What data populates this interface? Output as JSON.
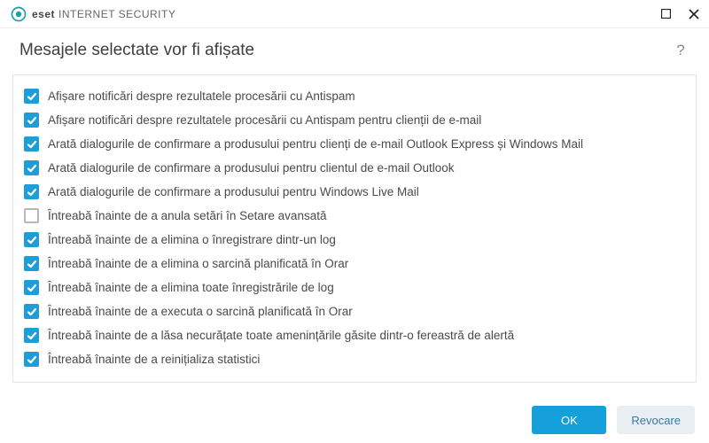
{
  "brand": {
    "bold": "eset",
    "light": "INTERNET SECURITY"
  },
  "title": "Mesajele selectate vor fi afișate",
  "help": "?",
  "items": [
    {
      "checked": true,
      "label": "Afișare notificări despre rezultatele procesării cu Antispam"
    },
    {
      "checked": true,
      "label": "Afișare notificări despre rezultatele procesării cu Antispam pentru clienții de e-mail"
    },
    {
      "checked": true,
      "label": "Arată dialogurile de confirmare a produsului pentru clienți de e-mail Outlook Express și Windows Mail"
    },
    {
      "checked": true,
      "label": "Arată dialogurile de confirmare a produsului pentru clientul de e-mail Outlook"
    },
    {
      "checked": true,
      "label": "Arată dialogurile de confirmare a produsului pentru Windows Live Mail"
    },
    {
      "checked": false,
      "label": "Întreabă înainte de a anula setări în Setare avansată"
    },
    {
      "checked": true,
      "label": "Întreabă înainte de a elimina o înregistrare dintr-un log"
    },
    {
      "checked": true,
      "label": "Întreabă înainte de a elimina o sarcină planificată în Orar"
    },
    {
      "checked": true,
      "label": "Întreabă înainte de a elimina toate înregistrările de log"
    },
    {
      "checked": true,
      "label": "Întreabă înainte de a executa o sarcină planificată în Orar"
    },
    {
      "checked": true,
      "label": "Întreabă înainte de a lăsa necurățate toate amenințările găsite dintr-o fereastră de alertă"
    },
    {
      "checked": true,
      "label": "Întreabă înainte de a reinițializa statistici"
    }
  ],
  "buttons": {
    "ok": "OK",
    "cancel": "Revocare"
  }
}
